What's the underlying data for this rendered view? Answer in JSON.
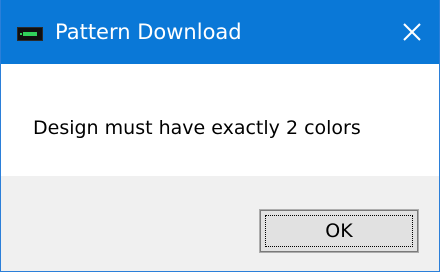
{
  "window": {
    "title": "Pattern Download",
    "icon": "app-icon",
    "close_icon": "close-icon"
  },
  "dialog": {
    "message": "Design must have exactly 2 colors",
    "ok_label": "OK"
  },
  "colors": {
    "titlebar": "#0a78d7",
    "content_background": "#ffffff",
    "footer_background": "#f0f0f0",
    "button_background": "#e1e1e1"
  }
}
